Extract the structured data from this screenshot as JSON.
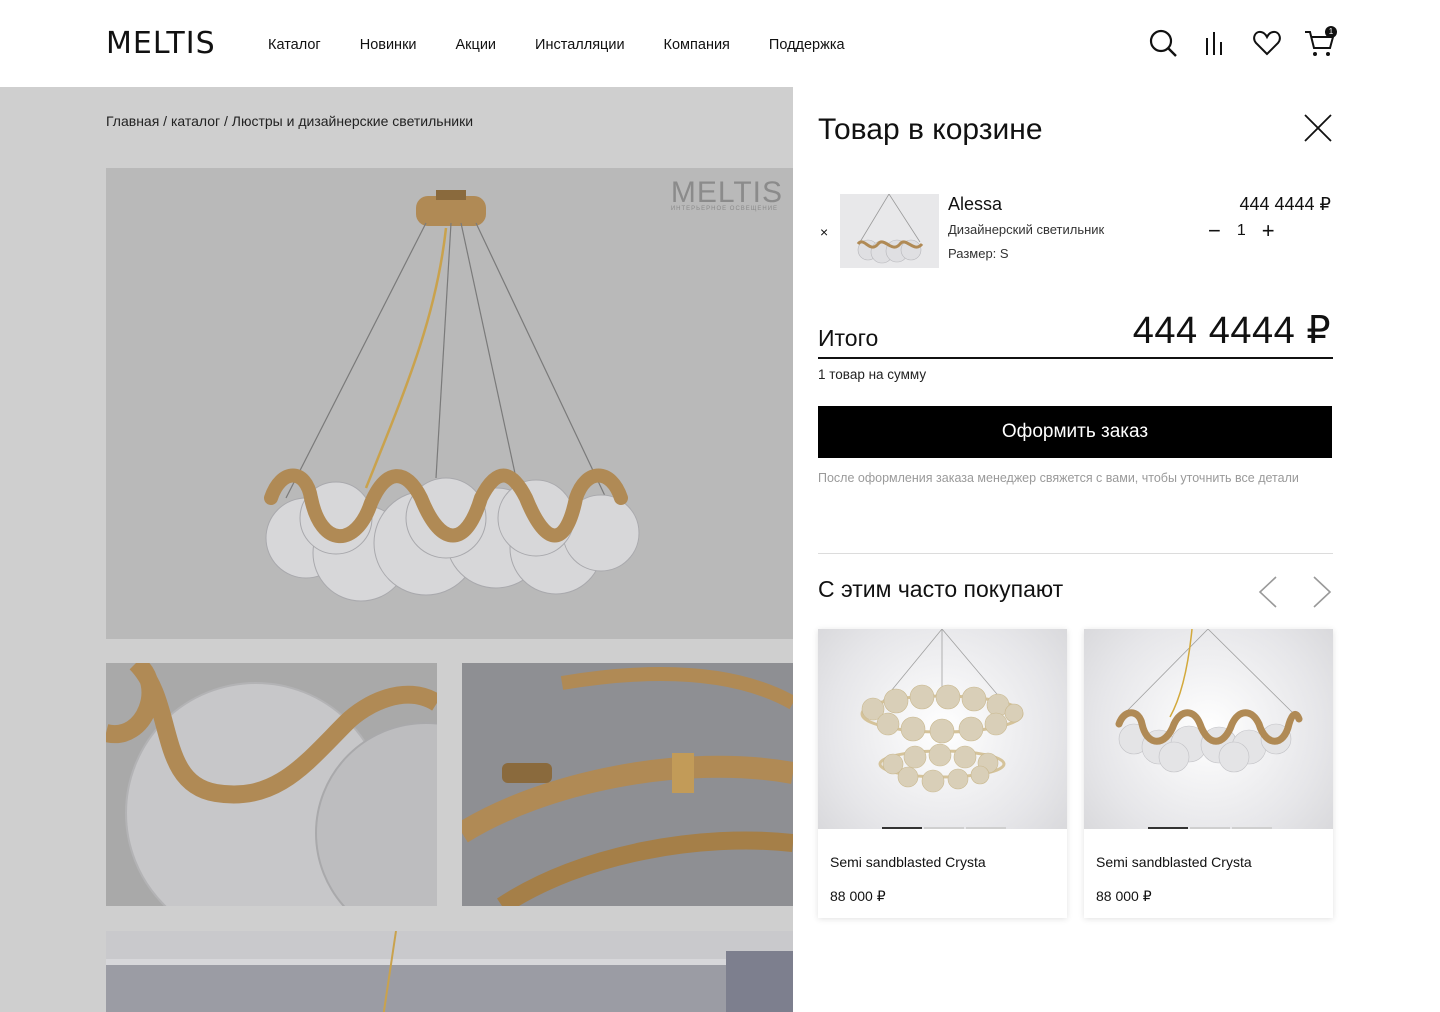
{
  "brand": {
    "logo": "MELTIS",
    "watermark": "MELTIS",
    "watermark_sub": "ИНТЕРЬЕРНОЕ ОСВЕЩЕНИЕ"
  },
  "nav": {
    "items": [
      {
        "label": "Каталог"
      },
      {
        "label": "Новинки"
      },
      {
        "label": "Акции"
      },
      {
        "label": "Инсталляции"
      },
      {
        "label": "Компания"
      },
      {
        "label": "Поддержка"
      }
    ]
  },
  "header_icons": {
    "search": "search-icon",
    "compare": "compare-icon",
    "favorites": "heart-icon",
    "cart": "cart-icon",
    "cart_count": "1"
  },
  "breadcrumb": "Главная / каталог / Люстры и дизайнерские светильники",
  "cart": {
    "title": "Товар в корзине",
    "item": {
      "name": "Alessa",
      "description": "Дизайнерский светильник",
      "size": "Размер: S",
      "price": "444 4444 ₽",
      "quantity": "1",
      "remove": "×",
      "minus": "−",
      "plus": "+"
    },
    "total_label": "Итого",
    "total_value": "444 4444 ₽",
    "total_sub": "1 товар на сумму",
    "order_button": "Оформить заказ",
    "order_note": "После оформления заказа менеджер свяжется с вами, чтобы уточнить все детали"
  },
  "recommendations": {
    "title": "С этим часто покупают",
    "items": [
      {
        "name": "Semi sandblasted Crysta",
        "price": "88 000 ₽"
      },
      {
        "name": "Semi sandblasted Crysta",
        "price": "88 000 ₽"
      }
    ]
  },
  "colors": {
    "accent": "#000000",
    "gold": "#b8935a",
    "overlay": "#cfcfcf"
  }
}
